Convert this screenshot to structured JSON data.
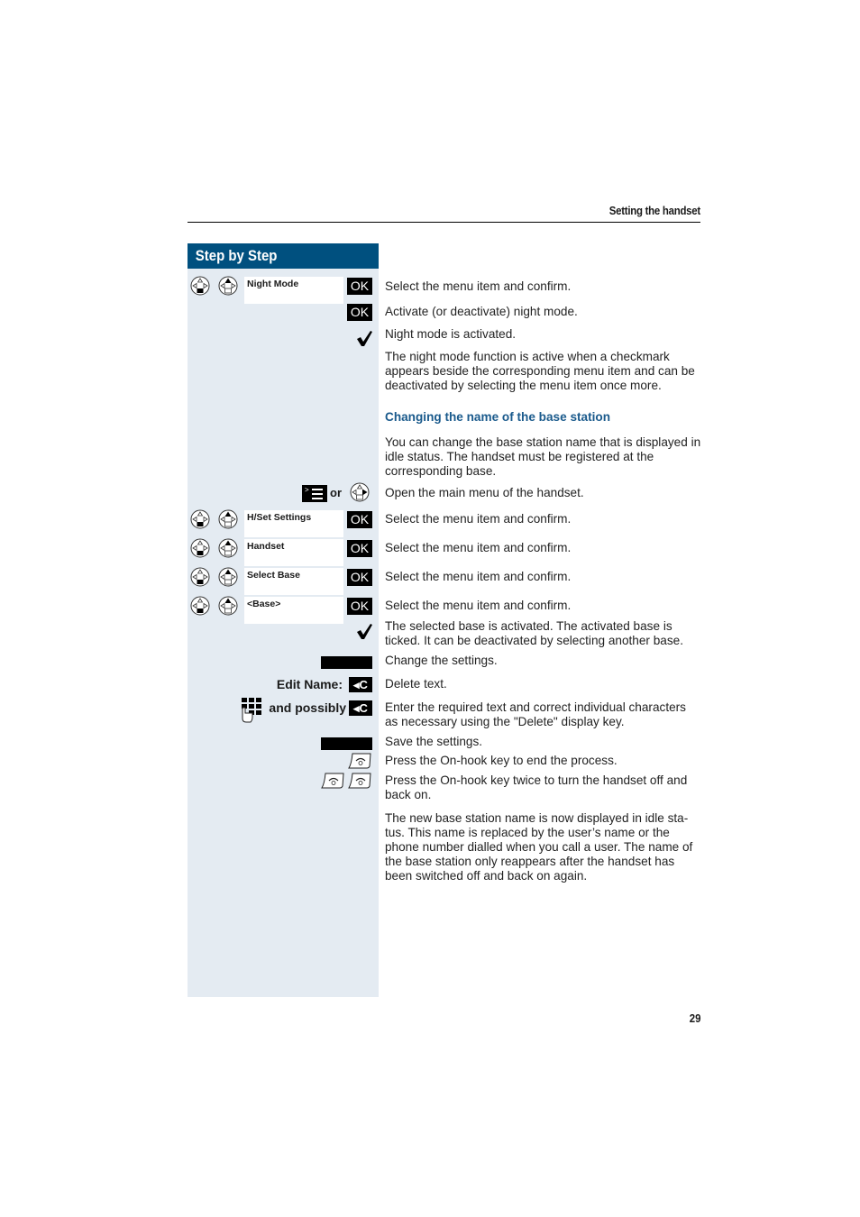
{
  "header": {
    "section_title": "Setting the handset"
  },
  "sidebar": {
    "title": "Step by Step"
  },
  "steps": [
    {
      "display": "Night Mode",
      "key": "OK",
      "text": "Select the menu item and confirm."
    },
    {
      "key": "OK",
      "text": "Activate (or deactivate) night mode."
    },
    {
      "icon": "checkmark",
      "text": "Night mode is activated."
    },
    {
      "text": "The night mode function is active when a checkmark appears beside the corresponding menu item and can be deactivated by selecting the menu item once more."
    }
  ],
  "section2": {
    "heading": "Changing the name of the base station",
    "intro": "You can change the base station name that is displayed in idle status. The handset must be registered at the corresponding base.",
    "menu_step": {
      "or_label": "or",
      "text": "Open the main menu of the handset."
    },
    "menu_steps": [
      {
        "display": "H/Set Settings",
        "key": "OK",
        "text": "Select the menu item and confirm."
      },
      {
        "display": "Handset",
        "key": "OK",
        "text": "Select the menu item and confirm."
      },
      {
        "display": "Select Base",
        "key": "OK",
        "text": "Select the menu item and confirm."
      },
      {
        "display": "<Base>",
        "key": "OK",
        "text": "Select the menu item and confirm."
      }
    ],
    "tick_text": "The selected base is activated. The activated base is ticked. It can be deactivated by selecting another base.",
    "change_text": "Change the settings.",
    "edit_label": "Edit Name:",
    "delete_key": "◂C",
    "delete_text": "Delete text.",
    "possibly_label": "and possibly",
    "enter_text": "Enter the required text and correct individual characters as necessary using the \"Delete\" display key.",
    "save_text": "Save the settings.",
    "onhook_text": "Press the On-hook key to end the process.",
    "onhook_twice_text": "Press the On-hook key twice to turn the handset off and back on.",
    "final_text": "The new base station name is now displayed in idle sta-tus. This name is replaced by the user’s name or the phone number dialled when you call a user. The name of the base station only reappears after the handset has been switched off and back on again."
  },
  "page_number": "29"
}
